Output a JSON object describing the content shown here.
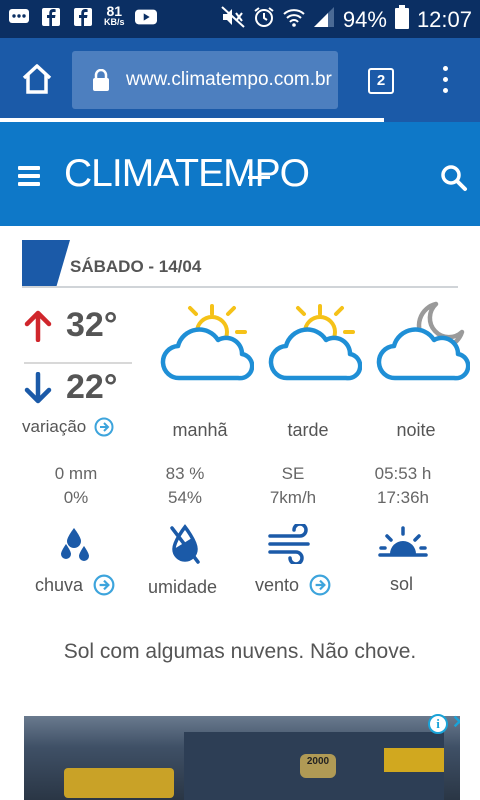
{
  "status_bar": {
    "speed_value": "81",
    "speed_unit": "KB/s",
    "battery": "94%",
    "time": "12:07"
  },
  "browser": {
    "url": "www.climatempo.com.br",
    "tab_count": "2"
  },
  "site": {
    "logo": "CLIMATEMPO"
  },
  "forecast": {
    "date_label": "SÁBADO - 14/04",
    "temp_max": "32°",
    "temp_min": "22°",
    "variacao_label": "variação",
    "periods": [
      {
        "label": "manhã",
        "icon": "sun-cloud-icon"
      },
      {
        "label": "tarde",
        "icon": "sun-cloud-icon"
      },
      {
        "label": "noite",
        "icon": "moon-cloud-icon"
      }
    ],
    "stats": {
      "chuva": {
        "line1": "0 mm",
        "line2": "0%",
        "label": "chuva"
      },
      "umidade": {
        "line1": "83 %",
        "line2": "54%",
        "label": "umidade"
      },
      "vento": {
        "line1": "SE",
        "line2": "7km/h",
        "label": "vento"
      },
      "sol": {
        "line1": "05:53 h",
        "line2": "17:36h",
        "label": "sol"
      }
    },
    "description": "Sol com algumas nuvens. Não chove."
  },
  "ad": {
    "badge_text": "2000"
  },
  "colors": {
    "status_bg": "#0b2f63",
    "browser_bg": "#1b5aa8",
    "header_bg": "#0e78c8",
    "up_arrow": "#d0262c",
    "down_arrow": "#1b5aa8",
    "icon_blue": "#1f8fd6",
    "sun_yellow": "#f5c218"
  }
}
